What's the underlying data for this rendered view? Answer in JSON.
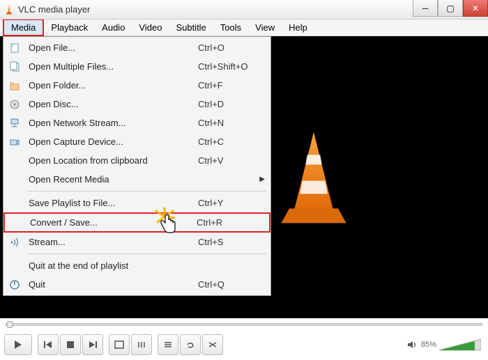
{
  "title": "VLC media player",
  "menubar": [
    "Media",
    "Playback",
    "Audio",
    "Video",
    "Subtitle",
    "Tools",
    "View",
    "Help"
  ],
  "dropdown": {
    "groups": [
      [
        {
          "icon": "file",
          "label": "Open File...",
          "shortcut": "Ctrl+O"
        },
        {
          "icon": "files",
          "label": "Open Multiple Files...",
          "shortcut": "Ctrl+Shift+O"
        },
        {
          "icon": "folder",
          "label": "Open Folder...",
          "shortcut": "Ctrl+F"
        },
        {
          "icon": "disc",
          "label": "Open Disc...",
          "shortcut": "Ctrl+D"
        },
        {
          "icon": "network",
          "label": "Open Network Stream...",
          "shortcut": "Ctrl+N"
        },
        {
          "icon": "capture",
          "label": "Open Capture Device...",
          "shortcut": "Ctrl+C"
        },
        {
          "icon": "",
          "label": "Open Location from clipboard",
          "shortcut": "Ctrl+V"
        },
        {
          "icon": "",
          "label": "Open Recent Media",
          "shortcut": "",
          "submenu": true
        }
      ],
      [
        {
          "icon": "",
          "label": "Save Playlist to File...",
          "shortcut": "Ctrl+Y"
        },
        {
          "icon": "",
          "label": "Convert / Save...",
          "shortcut": "Ctrl+R",
          "highlight": true
        },
        {
          "icon": "stream",
          "label": "Stream...",
          "shortcut": "Ctrl+S"
        }
      ],
      [
        {
          "icon": "",
          "label": "Quit at the end of playlist",
          "shortcut": ""
        },
        {
          "icon": "quit",
          "label": "Quit",
          "shortcut": "Ctrl+Q"
        }
      ]
    ]
  },
  "volume_percent": "85%"
}
